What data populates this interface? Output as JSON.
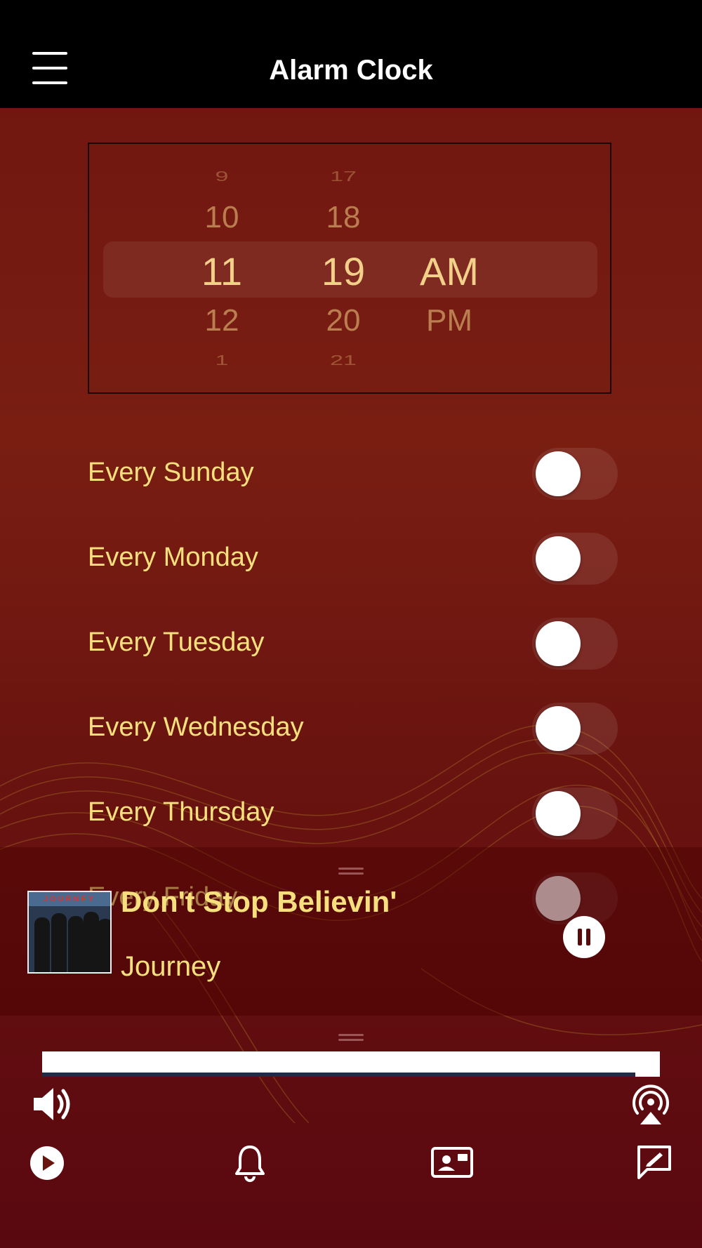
{
  "header": {
    "title": "Alarm Clock",
    "menu_icon": "hamburger-menu-icon"
  },
  "time_picker": {
    "hours": [
      "9",
      "10",
      "11",
      "12",
      "1"
    ],
    "minutes": [
      "17",
      "18",
      "19",
      "20",
      "21"
    ],
    "periods": [
      "AM",
      "PM"
    ],
    "selected_hour": "11",
    "selected_minute": "19",
    "selected_period": "AM"
  },
  "days": [
    {
      "label": "Every Sunday",
      "on": false
    },
    {
      "label": "Every Monday",
      "on": false
    },
    {
      "label": "Every Tuesday",
      "on": false
    },
    {
      "label": "Every Wednesday",
      "on": false
    },
    {
      "label": "Every Thursday",
      "on": false
    },
    {
      "label": "Every Friday",
      "on": false
    }
  ],
  "now_playing": {
    "title": "Don't Stop Believin'",
    "artist": "Journey",
    "album_art_band": "JOURNEY",
    "state": "playing",
    "pause_icon": "pause-icon"
  },
  "bottom_bar": {
    "volume_icon": "speaker-volume-icon",
    "airplay_icon": "airplay-icon",
    "tabs": [
      {
        "icon": "play-circle-icon"
      },
      {
        "icon": "bell-icon"
      },
      {
        "icon": "contact-card-icon"
      },
      {
        "icon": "message-edit-icon"
      }
    ]
  },
  "colors": {
    "accent_text": "#f6e07e",
    "picker_text": "#e8c07a",
    "background": "#6e1510",
    "header": "#000000"
  }
}
